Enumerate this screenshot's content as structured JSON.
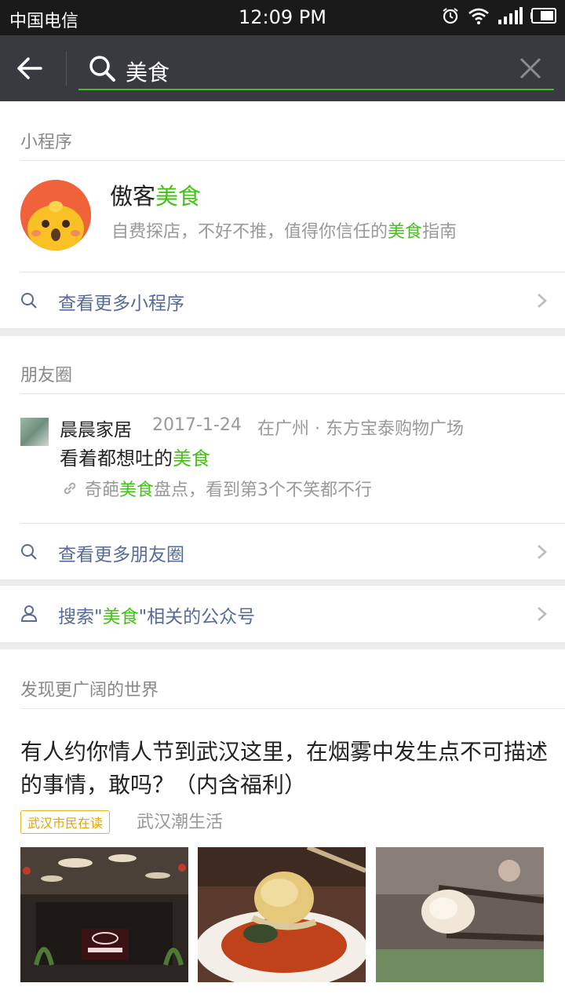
{
  "status": {
    "carrier": "中国电信",
    "time": "12:09 PM"
  },
  "search": {
    "query": "美食"
  },
  "miniprogram": {
    "section_title": "小程序",
    "name_plain": "傲客",
    "name_hl": "美食",
    "desc_before": "自费探店，不好不推，值得你信任的",
    "desc_hl": "美食",
    "desc_after": "指南",
    "more_label": "查看更多小程序"
  },
  "moments": {
    "section_title": "朋友圈",
    "user": "晨晨家居",
    "date": "2017-1-24",
    "location": "在广州 · 东方宝泰购物广场",
    "text_before": "看着都想吐的",
    "text_hl": "美食",
    "link_before": "奇葩",
    "link_hl": "美食",
    "link_after": "盘点，看到第3个不笑都不行",
    "more_label": "查看更多朋友圈"
  },
  "accounts": {
    "prefix": "搜索\"",
    "hl": "美食",
    "suffix": "\"相关的公众号"
  },
  "discover": {
    "section_title": "发现更广阔的世界",
    "article_title": "有人约你情人节到武汉这里，在烟雾中发生点不可描述的事情，敢吗？（内含福利）",
    "tag": "武汉市民在读",
    "source": "武汉潮生活",
    "images": [
      "restaurant-photo",
      "food-photo-1",
      "food-photo-2"
    ]
  },
  "colors": {
    "highlight": "#45c01a",
    "link": "#576b95",
    "topbar": "#393a3f"
  }
}
